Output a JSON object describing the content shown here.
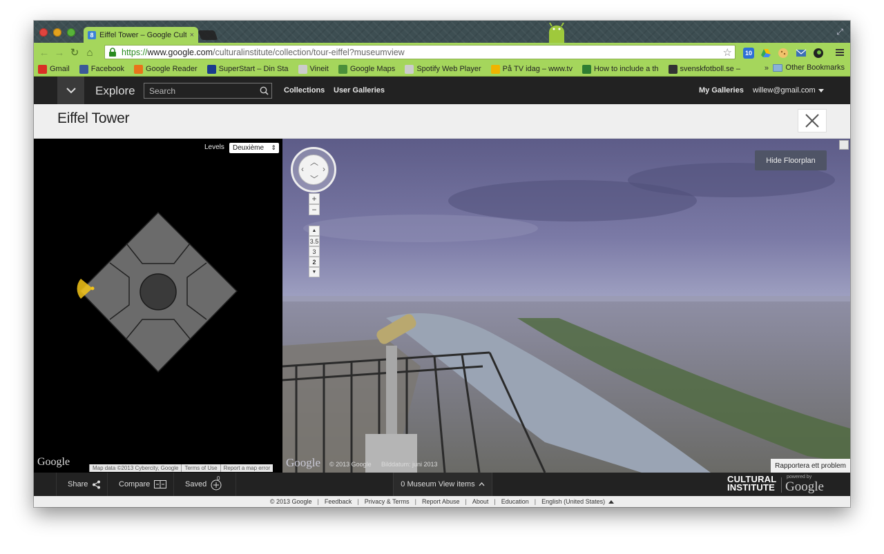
{
  "browser": {
    "tab_title": "Eiffel Tower – Google Cultu",
    "tab_close": "×",
    "url_scheme": "https://",
    "url_host": "www.google.com",
    "url_path": "/culturalinstitute/collection/tour-eiffel?museumview",
    "ext_badge": "10",
    "bookmarks": [
      {
        "label": "Gmail",
        "icon": "gmail-icon",
        "color": "#d93025"
      },
      {
        "label": "Facebook",
        "icon": "facebook-icon",
        "color": "#3b5998"
      },
      {
        "label": "Google Reader",
        "icon": "rss-icon",
        "color": "#e8741a"
      },
      {
        "label": "SuperStart – Din Sta",
        "icon": "superstart-icon",
        "color": "#1a3b8c"
      },
      {
        "label": "Vineit",
        "icon": "page-icon",
        "color": "#cccccc"
      },
      {
        "label": "Google Maps",
        "icon": "maps-icon",
        "color": "#4b8f3a"
      },
      {
        "label": "Spotify Web Player",
        "icon": "page-icon",
        "color": "#cccccc"
      },
      {
        "label": "På TV idag – www.tv",
        "icon": "tv-icon",
        "color": "#f0b400"
      },
      {
        "label": "How to include a th",
        "icon": "leaf-icon",
        "color": "#2e7d32"
      },
      {
        "label": "svenskfotboll.se –",
        "icon": "ball-icon",
        "color": "#333333"
      }
    ],
    "bookmarks_more": "»",
    "other_bookmarks": "Other Bookmarks"
  },
  "header": {
    "explore": "Explore",
    "search_placeholder": "Search",
    "nav": [
      "Collections",
      "User Galleries"
    ],
    "my_galleries": "My Galleries",
    "user_email": "willew@gmail.com"
  },
  "page": {
    "title": "Eiffel Tower"
  },
  "floorplan": {
    "levels_label": "Levels",
    "level_selected": "Deuxième",
    "google": "Google",
    "credits": [
      "Map data ©2013 Cybercity, Google",
      "Terms of Use",
      "Report a map error"
    ]
  },
  "streetview": {
    "hide_floorplan": "Hide Floorplan",
    "zoom_in": "+",
    "zoom_out": "−",
    "level_up": "▲",
    "levels": [
      "3.5",
      "3",
      "2"
    ],
    "active_level": "2",
    "level_down": "▼",
    "google": "Google",
    "copyright": "© 2013 Google",
    "capture_date": "Bilddatum: juni 2013",
    "report_problem": "Rapportera ett problem"
  },
  "bottom_bar": {
    "share": "Share",
    "compare": "Compare",
    "saved": "Saved",
    "saved_count": "0",
    "museum_items": "0 Museum View items",
    "ci_line1": "CULTURAL",
    "ci_line2": "INSTITUTE",
    "powered_by": "powered by",
    "google": "Google"
  },
  "footer": {
    "links": [
      "© 2013 Google",
      "Feedback",
      "Privacy & Terms",
      "Report Abuse",
      "About",
      "Education",
      "English (United States)"
    ]
  },
  "colors": {
    "chrome_green": "#a5d65c",
    "header_dark": "#222222",
    "floorplan_gray": "#6b6b6b",
    "marker_yellow": "#f5c518"
  }
}
